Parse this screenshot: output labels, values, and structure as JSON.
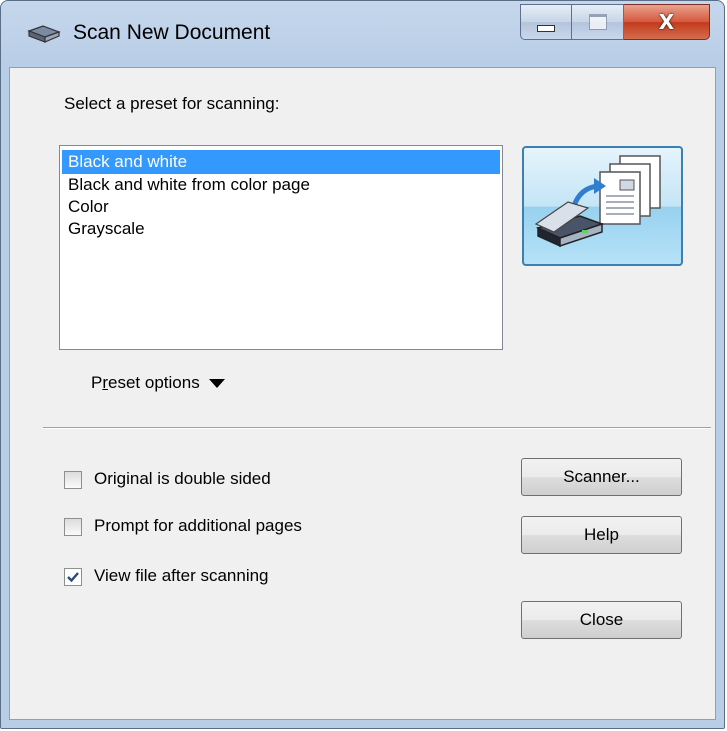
{
  "window": {
    "title": "Scan New Document",
    "controls": {
      "minimize": "minimize",
      "maximize": "maximize",
      "close": "X"
    }
  },
  "presets": {
    "label": "Select a preset for scanning:",
    "items": [
      "Black and white",
      "Black and white from color page",
      "Color",
      "Grayscale"
    ],
    "selected_index": 0,
    "options_link": {
      "prefix": "P",
      "underlined": "r",
      "suffix": "eset options"
    }
  },
  "scan_button": {
    "icon": "scanner-icon"
  },
  "options": {
    "double_sided": {
      "label": "Original is double sided",
      "checked": false
    },
    "prompt_pages": {
      "label": "Prompt for additional pages",
      "checked": false
    },
    "view_after": {
      "label": "View file after scanning",
      "checked": true
    }
  },
  "buttons": {
    "scanner": "Scanner...",
    "help": "Help",
    "close": "Close"
  },
  "colors": {
    "selection": "#3399ff",
    "scan_button_border": "#3c7fb1",
    "close_button_red": "#c23a1c"
  }
}
